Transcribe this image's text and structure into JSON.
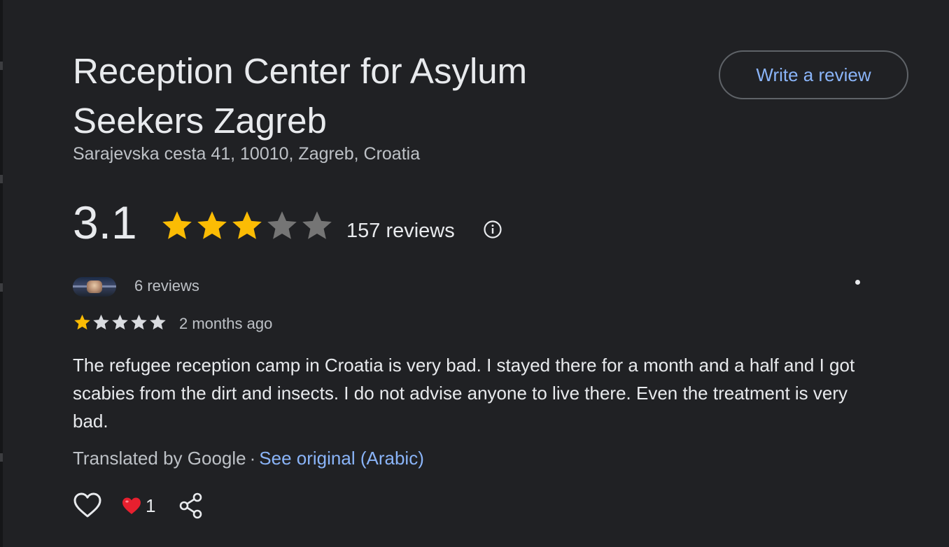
{
  "place": {
    "name": "Reception Center for Asylum Seekers Zagreb",
    "address": "Sarajevska cesta 41, 10010, Zagreb, Croatia"
  },
  "actions": {
    "write_review_label": "Write a review"
  },
  "rating": {
    "value": "3.1",
    "stars_filled": 3,
    "stars_total": 5,
    "review_count_label": "157 reviews",
    "star_color": "#fbbc04",
    "empty_star_color": "#757575"
  },
  "review": {
    "reviewer_reviews_label": "6 reviews",
    "stars_filled": 1,
    "stars_total": 5,
    "date": "2 months ago",
    "text": "The refugee reception camp in Croatia is very bad. I stayed there for a month and a half and I got scabies from the dirt and insects. I do not advise anyone to live there. Even the treatment is very bad.",
    "translated_label": "Translated by Google",
    "separator": "·",
    "see_original_label": "See original (Arabic)",
    "reaction_count": "1"
  },
  "icons": {
    "info": "info-icon",
    "like": "heart-outline-icon",
    "reaction": "heart-red-icon",
    "share": "share-icon",
    "more": "dot-icon"
  },
  "colors": {
    "background": "#202124",
    "link": "#8ab4f8",
    "text_primary": "#e8eaed",
    "text_secondary": "#bdc1c6"
  }
}
